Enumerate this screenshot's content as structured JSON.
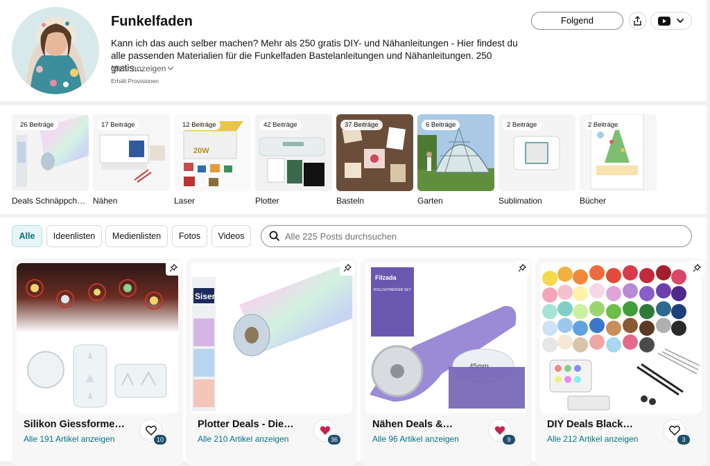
{
  "profile": {
    "name": "Funkelfaden",
    "bio": "Kann ich das auch selber machen? Mehr als 250 gratis DIY- und Nähanleitungen - Hier findest du alle passenden Materialien für die Funkelfaden Bastelanleitungen und Nähanleitungen. 250 gratis…",
    "more_label": "Mehr anzeigen",
    "commission_note": "Erhält Provisionen",
    "follow_label": "Folgend"
  },
  "categories": [
    {
      "count": "26 Beiträge",
      "label": "Deals Schnäppche…"
    },
    {
      "count": "17 Beiträge",
      "label": "Nähen"
    },
    {
      "count": "12 Beiträge",
      "label": "Laser"
    },
    {
      "count": "42 Beiträge",
      "label": "Plotter"
    },
    {
      "count": "37 Beiträge",
      "label": "Basteln"
    },
    {
      "count": "6 Beiträge",
      "label": "Garten"
    },
    {
      "count": "2 Beiträge",
      "label": "Sublimation"
    },
    {
      "count": "2 Beiträge",
      "label": "Bücher"
    }
  ],
  "filters": {
    "tabs": [
      "Alle",
      "Ideenlisten",
      "Medienlisten",
      "Fotos",
      "Videos"
    ],
    "active": "Alle",
    "search_placeholder": "Alle 225 Posts durchsuchen"
  },
  "cards": [
    {
      "title": "Silikon Giessforme…",
      "link": "Alle 191 Artikel anzeigen",
      "count": "10",
      "liked": false
    },
    {
      "title": "Plotter Deals - Die…",
      "link": "Alle 210 Artikel anzeigen",
      "count": "36",
      "liked": true
    },
    {
      "title": "Nähen Deals &…",
      "link": "Alle 96 Artikel anzeigen",
      "count": "9",
      "liked": true
    },
    {
      "title": "DIY Deals Black…",
      "link": "Alle 212 Artikel anzeigen",
      "count": "3",
      "liked": false
    }
  ],
  "image_text": {
    "laser_20w": "20W",
    "plotter_brand": "Siser",
    "rotary_brand": "Filzada",
    "rotary_box_title": "ROLLSCHNEIDER SET",
    "rotary_blade_size": "45mm"
  },
  "colors": {
    "link": "#007185",
    "heart": "#c7254e",
    "count_badge": "#1f4e6b",
    "active_chip_bg": "#e7f5f7"
  }
}
